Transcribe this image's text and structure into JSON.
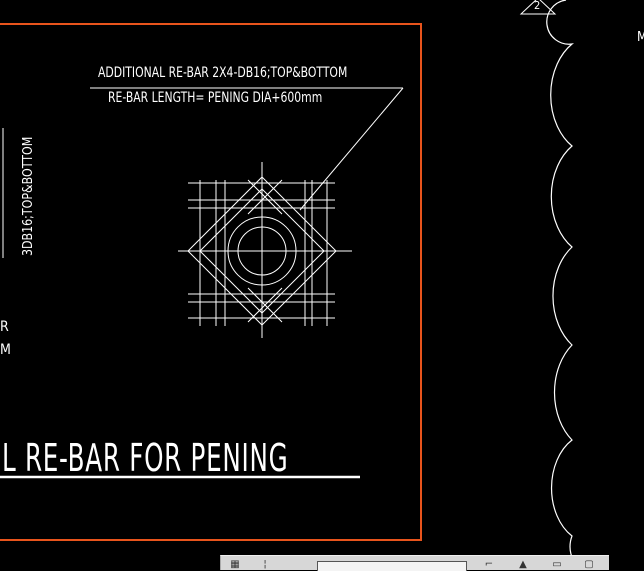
{
  "drawing": {
    "note_line1": "ADDITIONAL RE-BAR 2X4-DB16;TOP&BOTTOM",
    "note_line2": "RE-BAR LENGTH=  PENING DIA+600mm",
    "title": "L RE-BAR FOR  PENING",
    "side_vertical": "3DB16;TOP&BOTTOM",
    "side_r": "R",
    "side_m": "M",
    "corner_text": "M",
    "tag_number": "2"
  },
  "colors": {
    "background": "#000000",
    "line": "#ffffff",
    "border": "#e8541c",
    "toolbar": "#d7d7d7"
  },
  "toolbar": {
    "icons": [
      "grid-icon",
      "input-field",
      "snap-icon",
      "triangle-icon",
      "layout-icon"
    ]
  }
}
